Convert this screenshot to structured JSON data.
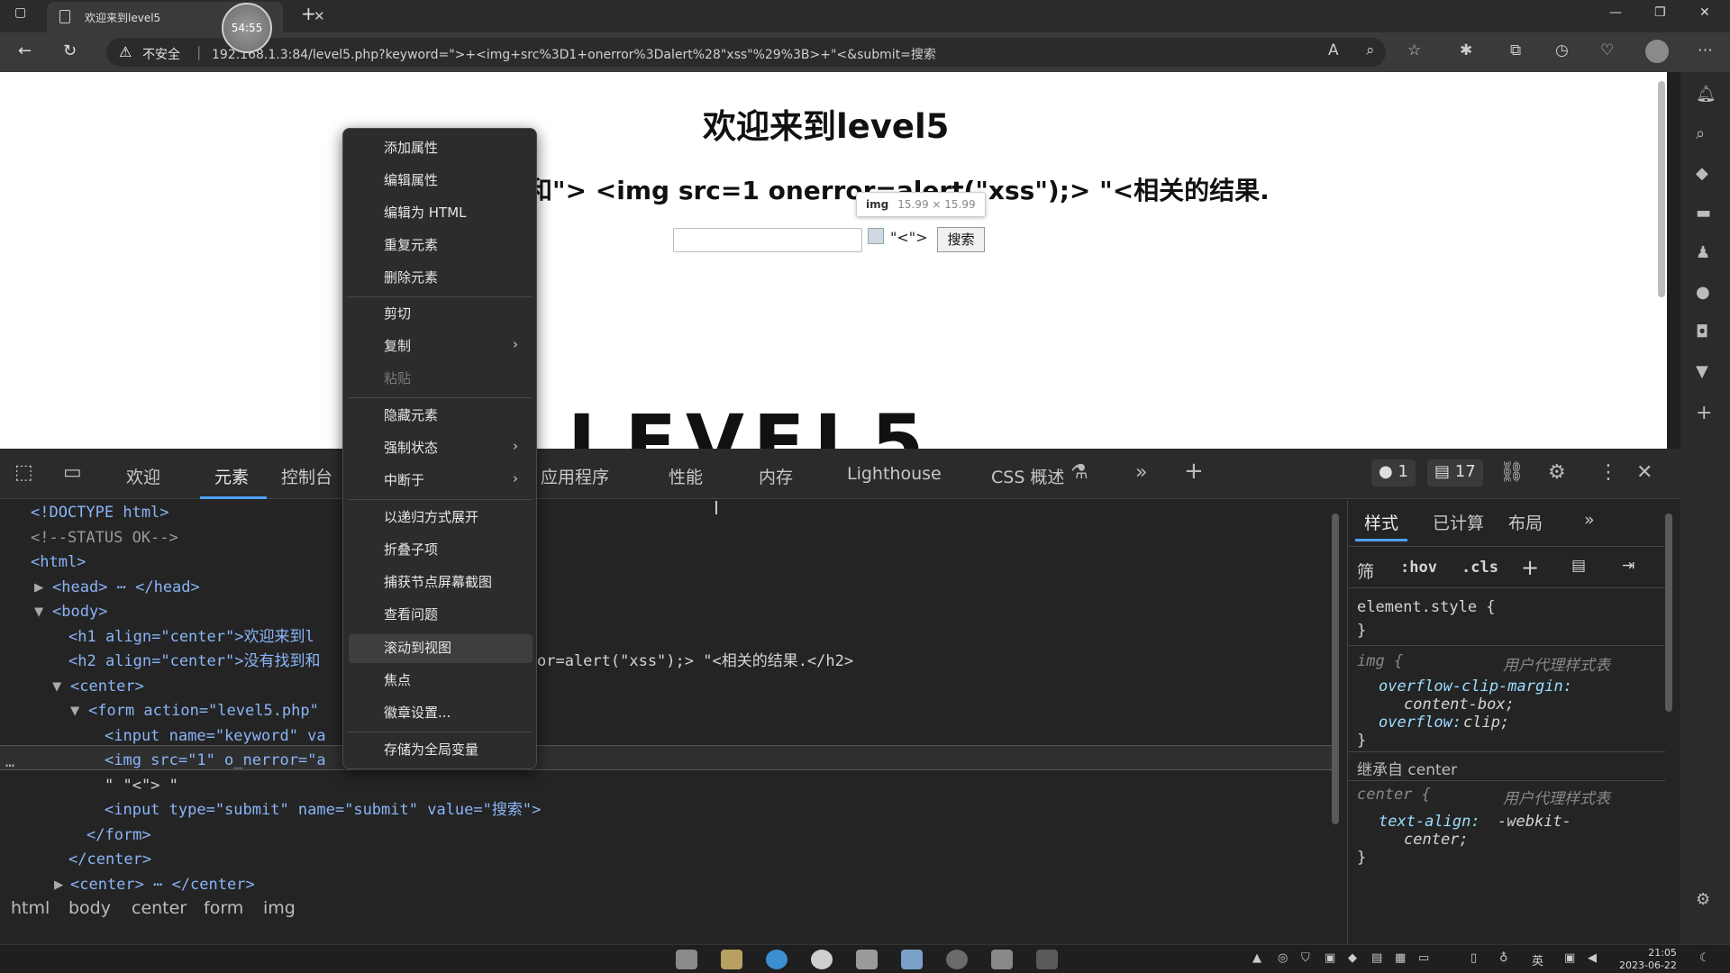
{
  "browser": {
    "tab_title": "欢迎来到level5",
    "timer": "54:55",
    "security_label": "不安全",
    "url": "192.168.1.3:84/level5.php?keyword=\">+<img+src%3D1+onerror%3Dalert%28\"xss\"%29%3B>+\"<&submit=搜索"
  },
  "page": {
    "h1": "欢迎来到level5",
    "h2": "没有找到和\"> <img src=1 onerror=alert(\"xss\");> \"<相关的结果.",
    "h2_visible": "和\"> <img src=1 onerror=alert(\"xss\");> \"<相关的结果.",
    "input_value": "",
    "quote_text": "\"<\">",
    "search_button": "搜索",
    "tooltip_tag": "img",
    "tooltip_size": "15.99 × 15.99",
    "logo_text": "LEVEL5"
  },
  "devtools": {
    "tabs": [
      "欢迎",
      "元素",
      "控制台",
      "应用程序",
      "性能",
      "内存",
      "Lighthouse",
      "CSS 概述"
    ],
    "active_tab": "元素",
    "issues_count": "1",
    "messages_count": "17",
    "styles_tabs": [
      "样式",
      "已计算",
      "布局"
    ],
    "filter_label": "筛",
    "hov_label": ":hov",
    "cls_label": ".cls",
    "breadcrumbs": [
      "html",
      "body",
      "center",
      "form",
      "img"
    ]
  },
  "dom_lines": [
    "<!DOCTYPE html>",
    "<!--STATUS OK-->",
    "<html>",
    "<head> ⋯ </head>",
    "<body>",
    "<h1 align=\"center\">欢迎来到l",
    "<h2 align=\"center\">没有找到和",
    "or=alert(\"xss\");> \"<相关的结果.</h2>",
    "<center>",
    "<form action=\"level5.php\"",
    "<input name=\"keyword\" va",
    "<img src=\"1\" o_nerror=\"a",
    "\" \"<\"> \"",
    "<input type=\"submit\" name=\"submit\" value=\"搜索\">",
    "</form>",
    "</center>",
    "<center> ⋯ </center>"
  ],
  "styles": {
    "element_style": "element.style {",
    "close_brace": "}",
    "img_selector": "img {",
    "ua_label": "用户代理样式表",
    "prop1_name": "overflow-clip-margin:",
    "prop1_value": "content-box;",
    "prop2_name": "overflow:",
    "prop2_value": "clip;",
    "inherited": "继承自 center",
    "center_selector": "center {",
    "prop3_name": "text-align:",
    "prop3_value": "-webkit-",
    "prop3_value2": "center;"
  },
  "context_menu": {
    "items": [
      "添加属性",
      "编辑属性",
      "编辑为 HTML",
      "重复元素",
      "删除元素",
      "剪切",
      "复制",
      "粘贴",
      "隐藏元素",
      "强制状态",
      "中断于",
      "以递归方式展开",
      "折叠子项",
      "捕获节点屏幕截图",
      "查看问题",
      "滚动到视图",
      "焦点",
      "徽章设置...",
      "存储为全局变量"
    ],
    "highlighted": "滚动到视图",
    "disabled": "粘贴"
  },
  "taskbar": {
    "time": "21:05",
    "date": "2023-06-22",
    "lang": "英"
  }
}
